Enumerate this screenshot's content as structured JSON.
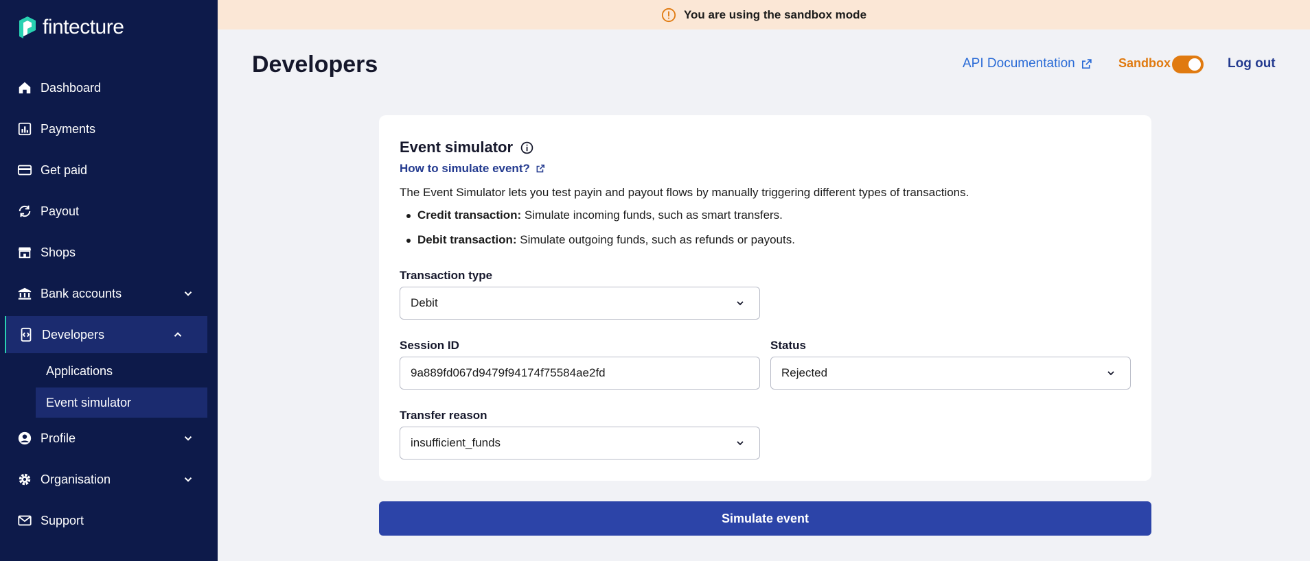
{
  "brand": {
    "name": "fintecture",
    "accent": "#29d1b2",
    "sidebar_bg": "#0d1a4a"
  },
  "sidebar": {
    "items": [
      {
        "label": "Dashboard",
        "icon": "home-icon"
      },
      {
        "label": "Payments",
        "icon": "bar-chart-icon"
      },
      {
        "label": "Get paid",
        "icon": "credit-card-icon"
      },
      {
        "label": "Payout",
        "icon": "sync-icon"
      },
      {
        "label": "Shops",
        "icon": "store-icon"
      },
      {
        "label": "Bank accounts",
        "icon": "bank-icon",
        "expandable": true
      },
      {
        "label": "Developers",
        "icon": "developer-icon",
        "expanded": true,
        "active": true
      },
      {
        "label": "Profile",
        "icon": "user-icon",
        "expandable": true
      },
      {
        "label": "Organisation",
        "icon": "gear-icon",
        "expandable": true
      },
      {
        "label": "Support",
        "icon": "mail-icon"
      }
    ],
    "sub_items": [
      {
        "label": "Applications"
      },
      {
        "label": "Event simulator",
        "active": true
      }
    ]
  },
  "banner": {
    "text": "You are using the sandbox mode",
    "color": "#fbe7d6"
  },
  "header": {
    "title": "Developers",
    "api_doc": "API Documentation",
    "sandbox": "Sandbox",
    "sandbox_on": true,
    "logout": "Log out"
  },
  "simulator": {
    "title": "Event simulator",
    "howto": "How to simulate event?",
    "description": "The Event Simulator lets you test payin and payout flows by manually triggering different types of transactions.",
    "bullets": [
      {
        "term": "Credit transaction:",
        "text": " Simulate incoming funds, such as smart transfers."
      },
      {
        "term": "Debit transaction:",
        "text": " Simulate outgoing funds, such as refunds or payouts."
      }
    ],
    "transaction_type": {
      "label": "Transaction type",
      "value": "Debit"
    },
    "session_id": {
      "label": "Session ID",
      "value": "9a889fd067d9479f94174f75584ae2fd"
    },
    "status": {
      "label": "Status",
      "value": "Rejected"
    },
    "transfer_reason": {
      "label": "Transfer reason",
      "value": "insufficient_funds"
    },
    "submit": "Simulate event"
  }
}
